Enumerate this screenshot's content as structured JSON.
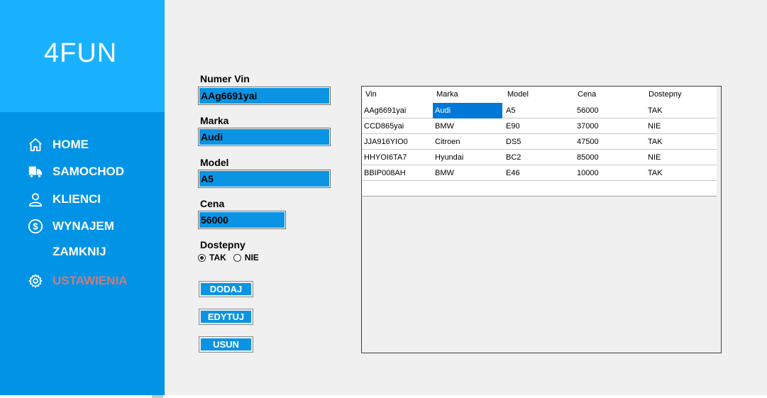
{
  "app": {
    "brand": "4FUN"
  },
  "sidebar": {
    "items": [
      {
        "label": "HOME",
        "icon": "home-icon"
      },
      {
        "label": "SAMOCHOD",
        "icon": "truck-icon"
      },
      {
        "label": "KLIENCI",
        "icon": "user-icon"
      },
      {
        "label": "WYNAJEM",
        "icon": "dollar-icon"
      },
      {
        "label": "ZAMKNIJ",
        "icon": ""
      },
      {
        "label": "USTAWIENIA",
        "icon": "gear-icon"
      }
    ]
  },
  "form": {
    "vin_label": "Numer Vin",
    "vin_value": "AAg6691yai",
    "marka_label": "Marka",
    "marka_value": "Audi",
    "model_label": "Model",
    "model_value": "A5",
    "cena_label": "Cena",
    "cena_value": "56000",
    "dostepny_label": "Dostepny",
    "radio_tak": "TAK",
    "radio_nie": "NIE",
    "selected": "TAK"
  },
  "buttons": {
    "dodaj": "DODAJ",
    "edytuj": "EDYTUJ",
    "usun": "USUN"
  },
  "table": {
    "columns": [
      "Vin",
      "Marka",
      "Model",
      "Cena",
      "Dostepny"
    ],
    "rows": [
      [
        "AAg6691yai",
        "Audi",
        "A5",
        "56000",
        "TAK"
      ],
      [
        "CCD865yai",
        "BMW",
        "E90",
        "37000",
        "NIE"
      ],
      [
        "JJA916YIO0",
        "Citroen",
        "DS5",
        "47500",
        "TAK"
      ],
      [
        "HHYOI6TA7",
        "Hyundai",
        "BC2",
        "85000",
        "NIE"
      ],
      [
        "BBIP008AH",
        "BMW",
        "E46",
        "10000",
        "TAK"
      ]
    ]
  },
  "colors": {
    "sidebar": "#0093e6",
    "brand_panel": "#1ab1ff",
    "input_bg": "#0a94e3",
    "selection": "#0078d7",
    "disabled_text": "#d07a78"
  }
}
